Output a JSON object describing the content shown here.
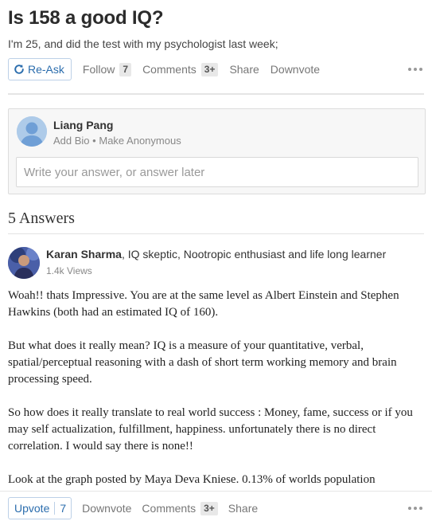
{
  "question": {
    "title": "Is 158 a good IQ?",
    "detail": "I'm 25, and did the test with my psychologist last week;"
  },
  "question_actions": {
    "reask": "Re-Ask",
    "follow": "Follow",
    "follow_count": "7",
    "comments": "Comments",
    "comments_count": "3+",
    "share": "Share",
    "downvote": "Downvote"
  },
  "composer": {
    "user_name": "Liang Pang",
    "add_bio": "Add Bio",
    "bullet": "•",
    "make_anonymous": "Make Anonymous",
    "placeholder": "Write your answer, or answer later"
  },
  "answers_header": "5 Answers",
  "answer": {
    "author_name": "Karan Sharma",
    "author_credential": ", IQ skeptic, Nootropic enthusiast and life long learner",
    "views": "1.4k Views",
    "paragraphs": [
      "Woah!! thats Impressive. You are at the same level as Albert Einstein and Stephen Hawkins (both had an estimated IQ of 160).",
      "But what does it really mean? IQ is a measure of your quantitative, verbal, spatial/perceptual reasoning with a dash of short term working memory and brain processing speed.",
      "So how does it really translate to real world success : Money, fame, success or if you may self actualization, fulfillment, happiness. unfortunately there is no direct correlation. I would say there is none!!",
      "Look at the graph posted by Maya Deva Kniese. 0.13% of worlds population"
    ]
  },
  "answer_actions": {
    "upvote": "Upvote",
    "upvote_count": "7",
    "downvote": "Downvote",
    "comments": "Comments",
    "comments_count": "3+",
    "share": "Share"
  },
  "colors": {
    "accent_blue": "#2b6dad",
    "count_badge": "#e8e8e8",
    "composer_bg": "#f7f7f7"
  },
  "icons": {
    "reask": "refresh-icon",
    "more": "more-options-icon",
    "avatar_default": "default-user-avatar-icon"
  }
}
